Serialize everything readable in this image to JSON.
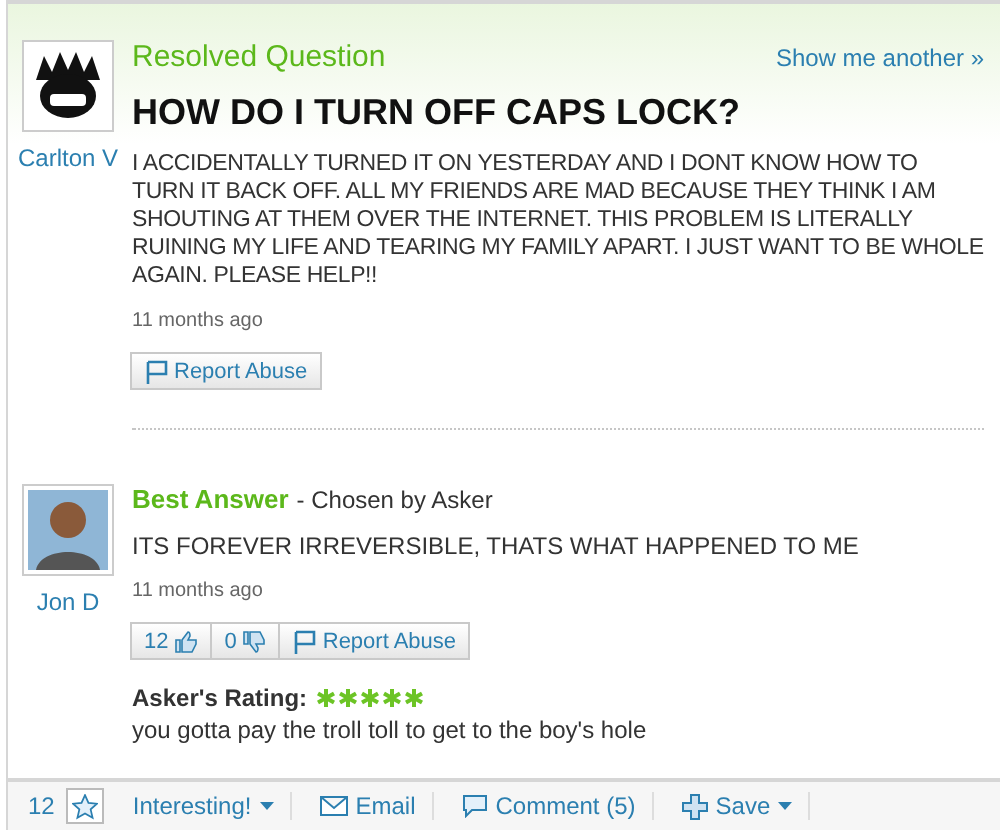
{
  "question": {
    "status": "Resolved Question",
    "show_another": "Show me another »",
    "title": "HOW DO I TURN OFF CAPS LOCK?",
    "asker": "Carlton V",
    "body": "I ACCIDENTALLY TURNED IT ON YESTERDAY AND I DONT KNOW HOW TO TURN IT BACK OFF. ALL MY FRIENDS ARE MAD BECAUSE THEY THINK I AM SHOUTING AT THEM OVER THE INTERNET. THIS PROBLEM IS LITERALLY RUINING MY LIFE AND TEARING MY FAMILY APART. I JUST WANT TO BE WHOLE AGAIN. PLEASE HELP!!",
    "time": "11 months ago",
    "report": "Report Abuse"
  },
  "answer": {
    "heading": "Best Answer",
    "chosen": "- Chosen by Asker",
    "answerer": "Jon D",
    "body": "ITS FOREVER IRREVERSIBLE, THATS WHAT HAPPENED TO ME",
    "time": "11 months ago",
    "thumbs_up": "12",
    "thumbs_down": "0",
    "report": "Report Abuse",
    "rating_label": "Asker's Rating:",
    "stars": 5,
    "comment": "you gotta pay the troll toll to get to the boy's hole"
  },
  "toolbar": {
    "interesting_count": "12",
    "interesting": "Interesting!",
    "email": "Email",
    "comment": "Comment (5)",
    "save": "Save"
  }
}
